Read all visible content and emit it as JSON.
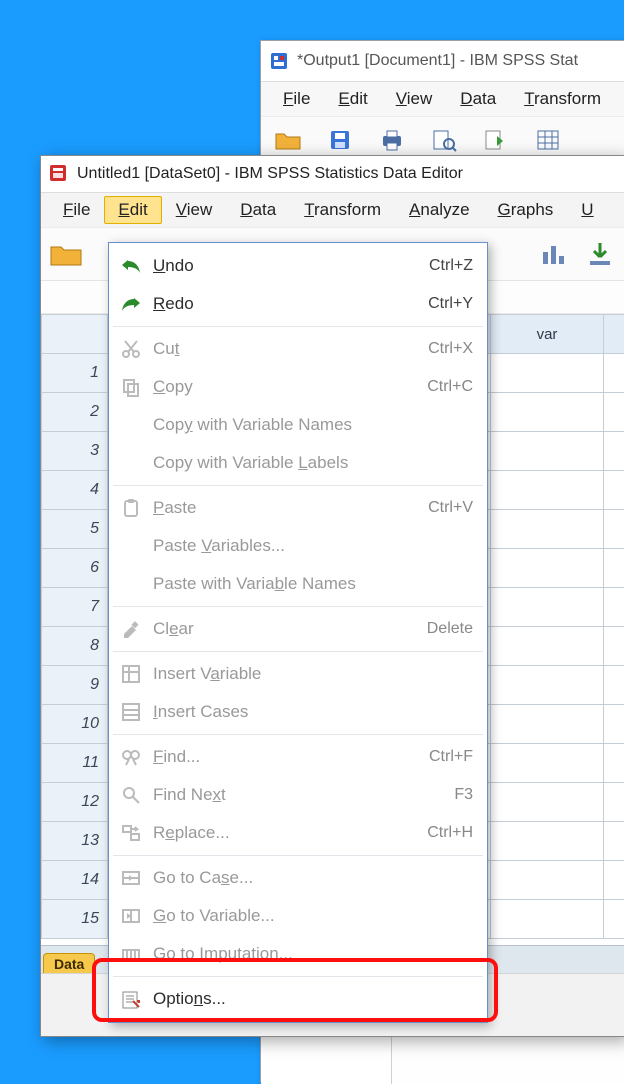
{
  "bg_window": {
    "title": "*Output1 [Document1] - IBM SPSS Stat",
    "menus": {
      "file": "File",
      "edit": "Edit",
      "view": "View",
      "data": "Data",
      "transform": "Transform"
    }
  },
  "fg_window": {
    "title": "Untitled1 [DataSet0] - IBM SPSS Statistics Data Editor",
    "menus": {
      "file": "File",
      "edit": "Edit",
      "view": "View",
      "data": "Data",
      "transform": "Transform",
      "analyze": "Analyze",
      "graphs": "Graphs",
      "utilities_initial": "U"
    },
    "column_header": "var",
    "tab_label": "Data",
    "row_numbers": [
      "1",
      "2",
      "3",
      "4",
      "5",
      "6",
      "7",
      "8",
      "9",
      "10",
      "11",
      "12",
      "13",
      "14",
      "15"
    ]
  },
  "edit_menu": {
    "undo": {
      "label": "Undo",
      "shortcut": "Ctrl+Z"
    },
    "redo": {
      "label": "Redo",
      "shortcut": "Ctrl+Y"
    },
    "cut": {
      "label": "Cut",
      "shortcut": "Ctrl+X"
    },
    "copy": {
      "label": "Copy",
      "shortcut": "Ctrl+C"
    },
    "copy_names": {
      "label": "Copy with Variable Names",
      "shortcut": ""
    },
    "copy_labels": {
      "label": "Copy with Variable Labels",
      "shortcut": ""
    },
    "paste": {
      "label": "Paste",
      "shortcut": "Ctrl+V"
    },
    "paste_vars": {
      "label": "Paste Variables...",
      "shortcut": ""
    },
    "paste_names": {
      "label": "Paste with Variable Names",
      "shortcut": ""
    },
    "clear": {
      "label": "Clear",
      "shortcut": "Delete"
    },
    "insert_var": {
      "label": "Insert Variable",
      "shortcut": ""
    },
    "insert_cases": {
      "label": "Insert Cases",
      "shortcut": ""
    },
    "find": {
      "label": "Find...",
      "shortcut": "Ctrl+F"
    },
    "find_next": {
      "label": "Find Next",
      "shortcut": "F3"
    },
    "replace": {
      "label": "Replace...",
      "shortcut": "Ctrl+H"
    },
    "goto_case": {
      "label": "Go to Case...",
      "shortcut": ""
    },
    "goto_var": {
      "label": "Go to Variable...",
      "shortcut": ""
    },
    "goto_imp": {
      "label": "Go to Imputation...",
      "shortcut": ""
    },
    "options": {
      "label": "Options...",
      "shortcut": ""
    }
  },
  "colors": {
    "highlight_red": "#ff0e0e",
    "menu_active_bg": "#ffe38f",
    "grid_header_bg": "#e1ecf7"
  }
}
